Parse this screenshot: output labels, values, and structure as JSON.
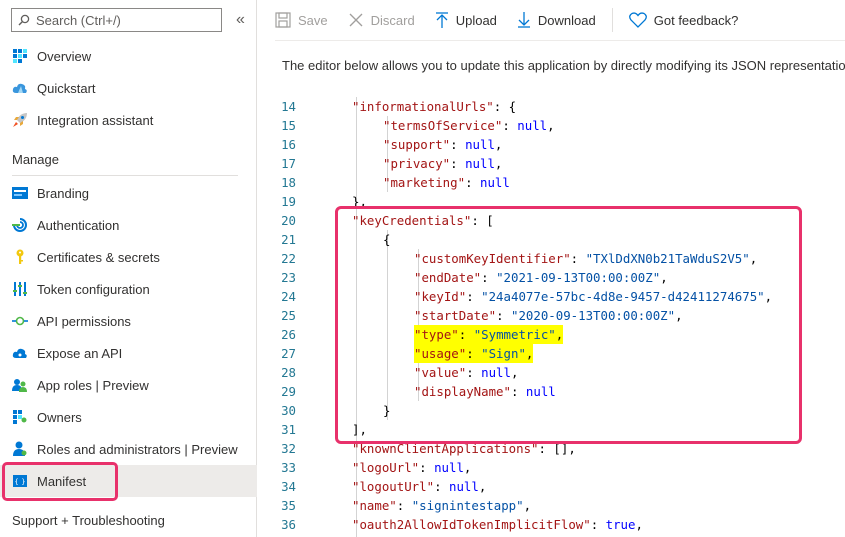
{
  "sidebar": {
    "search_placeholder": "Search (Ctrl+/)",
    "collapse_glyph": "«",
    "top_items": [
      {
        "label": "Overview",
        "icon": "overview-grid-icon"
      },
      {
        "label": "Quickstart",
        "icon": "cloud-icon"
      },
      {
        "label": "Integration assistant",
        "icon": "rocket-icon"
      }
    ],
    "manage_header": "Manage",
    "manage_items": [
      {
        "label": "Branding",
        "icon": "branding-icon"
      },
      {
        "label": "Authentication",
        "icon": "authentication-icon"
      },
      {
        "label": "Certificates & secrets",
        "icon": "key-icon"
      },
      {
        "label": "Token configuration",
        "icon": "token-bars-icon"
      },
      {
        "label": "API permissions",
        "icon": "api-permissions-icon"
      },
      {
        "label": "Expose an API",
        "icon": "cloud-api-icon"
      },
      {
        "label": "App roles | Preview",
        "icon": "app-roles-icon"
      },
      {
        "label": "Owners",
        "icon": "owners-icon"
      },
      {
        "label": "Roles and administrators | Preview",
        "icon": "roles-admin-icon"
      },
      {
        "label": "Manifest",
        "icon": "manifest-icon",
        "selected": true
      }
    ],
    "support_header": "Support + Troubleshooting"
  },
  "toolbar": {
    "save": "Save",
    "discard": "Discard",
    "upload": "Upload",
    "download": "Download",
    "feedback": "Got feedback?"
  },
  "description": "The editor below allows you to update this application by directly modifying its JSON representatio",
  "editor": {
    "line_numbers": [
      "14",
      "15",
      "16",
      "17",
      "18",
      "19",
      "20",
      "21",
      "22",
      "23",
      "24",
      "25",
      "26",
      "27",
      "28",
      "29",
      "30",
      "31",
      "32",
      "33",
      "34",
      "35",
      "36"
    ],
    "lines": [
      {
        "text": "\"informationalUrls\": {"
      },
      {
        "text": "\"termsOfService\": null,"
      },
      {
        "text": "\"support\": null,"
      },
      {
        "text": "\"privacy\": null,"
      },
      {
        "text": "\"marketing\": null"
      },
      {
        "text": "},"
      },
      {
        "text": "\"keyCredentials\": ["
      },
      {
        "text": "{"
      },
      {
        "text": "\"customKeyIdentifier\": \"TXlDdXN0b21TaWduS2V5\","
      },
      {
        "text": "\"endDate\": \"2021-09-13T00:00:00Z\","
      },
      {
        "text": "\"keyId\": \"24a4077e-57bc-4d8e-9457-d42411274675\","
      },
      {
        "text": "\"startDate\": \"2020-09-13T00:00:00Z\","
      },
      {
        "text": "\"type\": \"Symmetric\","
      },
      {
        "text": "\"usage\": \"Sign\","
      },
      {
        "text": "\"value\": null,"
      },
      {
        "text": "\"displayName\": null"
      },
      {
        "text": "}"
      },
      {
        "text": "],"
      },
      {
        "text": "\"knownClientApplications\": [],"
      },
      {
        "text": "\"logoUrl\": null,"
      },
      {
        "text": "\"logoutUrl\": null,"
      },
      {
        "text": "\"name\": \"signintestapp\","
      },
      {
        "text": "\"oauth2AllowIdTokenImplicitFlow\": true,"
      }
    ]
  },
  "colors": {
    "accent_highlight": "#e8316b",
    "selected_bg": "#edebe9",
    "json_key": "#a31515",
    "json_string": "#0451a5",
    "json_keyword": "#0000ff",
    "line_number": "#237893",
    "yellow_highlight": "#ffff00"
  }
}
